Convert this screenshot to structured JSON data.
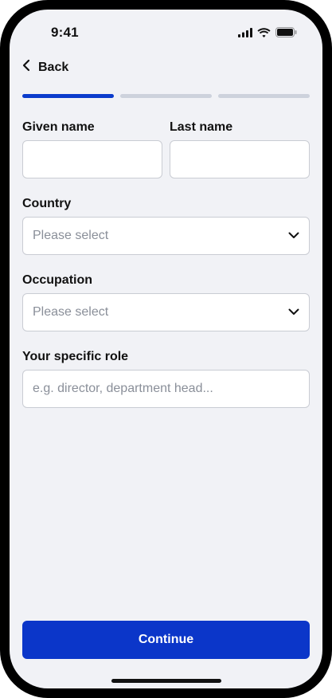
{
  "status_bar": {
    "time": "9:41",
    "icons": [
      "signal-icon",
      "wifi-icon",
      "battery-icon"
    ]
  },
  "nav": {
    "back_label": "Back",
    "back_icon": "chevron-left-icon"
  },
  "progress": {
    "steps_total": 3,
    "current_step": 1
  },
  "form": {
    "given_name": {
      "label": "Given name",
      "value": "",
      "placeholder": ""
    },
    "last_name": {
      "label": "Last name",
      "value": "",
      "placeholder": ""
    },
    "country": {
      "label": "Country",
      "value": "Please select",
      "icon": "chevron-down-icon"
    },
    "occupation": {
      "label": "Occupation",
      "value": "Please select",
      "icon": "chevron-down-icon"
    },
    "specific_role": {
      "label": "Your specific role",
      "value": "",
      "placeholder": "e.g. director, department head..."
    }
  },
  "footer": {
    "continue_label": "Continue"
  },
  "colors": {
    "accent": "#0b36c9",
    "progress_active": "#0b3ccc",
    "progress_inactive": "#cdd2dc",
    "background": "#f1f2f6",
    "input_border": "#c9ccd3",
    "placeholder": "#8a8f99"
  }
}
